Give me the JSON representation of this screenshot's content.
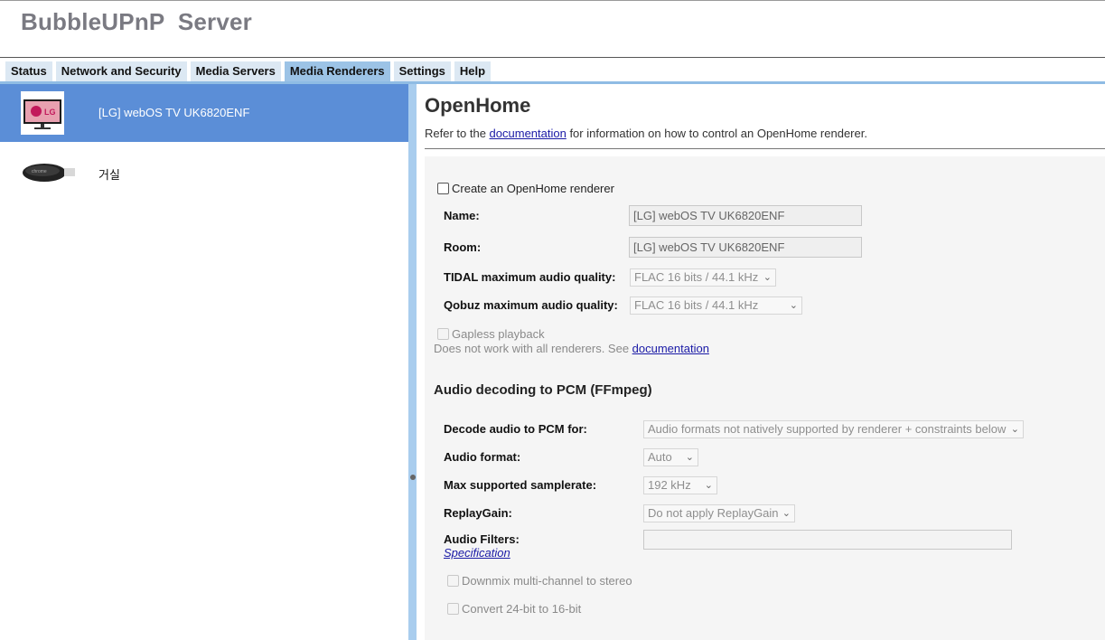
{
  "app": {
    "title": "BubbleUPnP  Server"
  },
  "tabs": [
    {
      "label": "Status",
      "active": false
    },
    {
      "label": "Network and Security",
      "active": false
    },
    {
      "label": "Media Servers",
      "active": false
    },
    {
      "label": "Media Renderers",
      "active": true
    },
    {
      "label": "Settings",
      "active": false
    },
    {
      "label": "Help",
      "active": false
    }
  ],
  "renderers": [
    {
      "name": "[LG] webOS TV UK6820ENF",
      "icon": "lg-tv-icon",
      "selected": true
    },
    {
      "name": "거실",
      "icon": "chromecast-icon",
      "selected": false
    }
  ],
  "openhome": {
    "title": "OpenHome",
    "intro_before": "Refer to the ",
    "intro_link": "documentation",
    "intro_after": " for information on how to control an OpenHome renderer.",
    "create_label": "Create an OpenHome renderer",
    "create_checked": false,
    "name_label": "Name:",
    "name_value": "[LG] webOS TV UK6820ENF",
    "room_label": "Room:",
    "room_value": "[LG] webOS TV UK6820ENF",
    "tidal_label": "TIDAL maximum audio quality:",
    "tidal_value": "FLAC 16 bits / 44.1 kHz",
    "qobuz_label": "Qobuz maximum audio quality:",
    "qobuz_value": "FLAC 16 bits / 44.1 kHz",
    "gapless_label": "Gapless playback",
    "gapless_note": "Does not work with all renderers. See ",
    "gapless_link": "documentation"
  },
  "decoding": {
    "title": "Audio decoding to PCM (FFmpeg)",
    "decode_label": "Decode audio to PCM for:",
    "decode_value": "Audio formats not natively supported by renderer + constraints below",
    "format_label": "Audio format:",
    "format_value": "Auto",
    "samplerate_label": "Max supported samplerate:",
    "samplerate_value": "192 kHz",
    "replaygain_label": "ReplayGain:",
    "replaygain_value": "Do not apply ReplayGain",
    "filters_label": "Audio Filters:",
    "filters_link": "Specification",
    "filters_value": "",
    "downmix_label": "Downmix multi-channel to stereo",
    "convert_label": "Convert 24-bit to 16-bit"
  },
  "colors": {
    "tab": "#dce8f3",
    "tab_active": "#9cc3e6",
    "selection": "#5b8ed7",
    "splitter": "#a9cdee"
  }
}
